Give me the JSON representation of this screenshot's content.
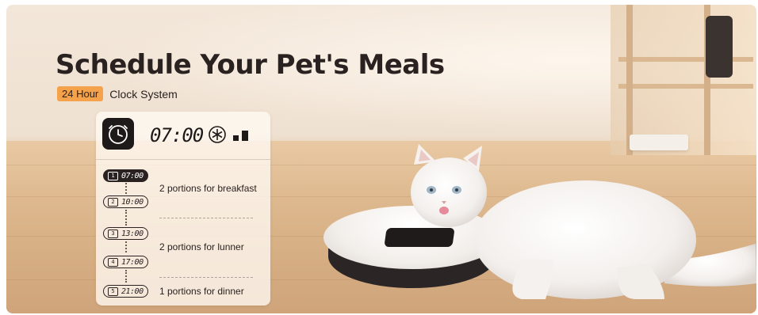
{
  "title": "Schedule Your Pet's Meals",
  "subtitle": {
    "badge": "24 Hour",
    "text": "Clock System"
  },
  "display": {
    "time": "07:00"
  },
  "schedule": [
    {
      "index": "1",
      "time": "07:00",
      "active": true
    },
    {
      "index": "2",
      "time": "10:00",
      "active": false
    },
    {
      "index": "3",
      "time": "13:00",
      "active": false
    },
    {
      "index": "4",
      "time": "17:00",
      "active": false
    },
    {
      "index": "5",
      "time": "21:00",
      "active": false
    }
  ],
  "portions": [
    "2 portions for breakfast",
    "2 portions for lunner",
    "1 portions for dinner"
  ],
  "colors": {
    "accent": "#f4a24b",
    "dark": "#2a2220",
    "card": "#fffaf4"
  },
  "icons": [
    "clock-icon",
    "snowflake-icon",
    "signal-bars-icon"
  ]
}
